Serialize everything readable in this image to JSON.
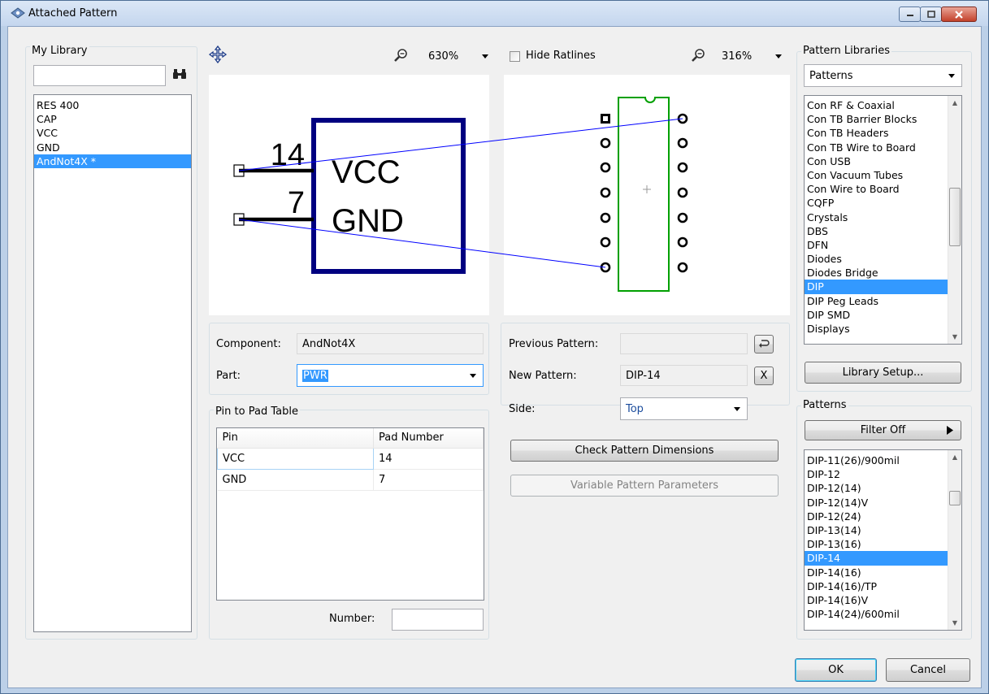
{
  "window": {
    "title": "Attached Pattern"
  },
  "my_library": {
    "label": "My Library",
    "search_value": "",
    "items": [
      {
        "label": "RES 400",
        "selected": false
      },
      {
        "label": "CAP",
        "selected": false
      },
      {
        "label": "VCC",
        "selected": false
      },
      {
        "label": "GND",
        "selected": false
      },
      {
        "label": "AndNot4X *",
        "selected": true
      }
    ]
  },
  "symbol_view": {
    "zoom": "630%",
    "pin_numbers": [
      "14",
      "7"
    ],
    "pin_names": [
      "VCC",
      "GND"
    ]
  },
  "pattern_view": {
    "hide_ratlines_label": "Hide Ratlines",
    "hide_ratlines_checked": false,
    "zoom": "316%"
  },
  "component_form": {
    "component_label": "Component:",
    "component_value": "AndNot4X",
    "part_label": "Part:",
    "part_value": "PWR"
  },
  "pin_table": {
    "label": "Pin to Pad Table",
    "columns": [
      "Pin",
      "Pad Number"
    ],
    "rows": [
      {
        "pin": "VCC",
        "pad": "14"
      },
      {
        "pin": "GND",
        "pad": "7"
      }
    ],
    "number_label": "Number:",
    "number_value": ""
  },
  "pattern_form": {
    "previous_label": "Previous Pattern:",
    "previous_value": "",
    "new_label": "New Pattern:",
    "new_value": "DIP-14",
    "clear_button": "X",
    "side_label": "Side:",
    "side_value": "Top",
    "check_button": "Check Pattern Dimensions",
    "variable_button": "Variable Pattern Parameters"
  },
  "pattern_libraries": {
    "label": "Pattern Libraries",
    "selected_library": "Patterns",
    "items": [
      {
        "label": "Con RF & Coaxial",
        "selected": false
      },
      {
        "label": "Con TB Barrier Blocks",
        "selected": false
      },
      {
        "label": "Con TB Headers",
        "selected": false
      },
      {
        "label": "Con TB Wire to Board",
        "selected": false
      },
      {
        "label": "Con USB",
        "selected": false
      },
      {
        "label": "Con Vacuum Tubes",
        "selected": false
      },
      {
        "label": "Con Wire to Board",
        "selected": false
      },
      {
        "label": "CQFP",
        "selected": false
      },
      {
        "label": "Crystals",
        "selected": false
      },
      {
        "label": "DBS",
        "selected": false
      },
      {
        "label": "DFN",
        "selected": false
      },
      {
        "label": "Diodes",
        "selected": false
      },
      {
        "label": "Diodes Bridge",
        "selected": false
      },
      {
        "label": "DIP",
        "selected": true
      },
      {
        "label": "DIP Peg Leads",
        "selected": false
      },
      {
        "label": "DIP SMD",
        "selected": false
      },
      {
        "label": "Displays",
        "selected": false
      }
    ],
    "setup_button": "Library Setup..."
  },
  "patterns": {
    "label": "Patterns",
    "filter_button": "Filter Off",
    "items": [
      {
        "label": "DIP-11(26)/900mil",
        "selected": false
      },
      {
        "label": "DIP-12",
        "selected": false
      },
      {
        "label": "DIP-12(14)",
        "selected": false
      },
      {
        "label": "DIP-12(14)V",
        "selected": false
      },
      {
        "label": "DIP-12(24)",
        "selected": false
      },
      {
        "label": "DIP-13(14)",
        "selected": false
      },
      {
        "label": "DIP-13(16)",
        "selected": false
      },
      {
        "label": "DIP-14",
        "selected": true
      },
      {
        "label": "DIP-14(16)",
        "selected": false
      },
      {
        "label": "DIP-14(16)/TP",
        "selected": false
      },
      {
        "label": "DIP-14(16)V",
        "selected": false
      },
      {
        "label": "DIP-14(24)/600mil",
        "selected": false
      }
    ]
  },
  "footer": {
    "ok_button": "OK",
    "cancel_button": "Cancel"
  },
  "colors": {
    "symbol_body": "#000080",
    "footprint_outline": "#008000",
    "ratline": "#0000ff",
    "selection": "#3399ff"
  }
}
